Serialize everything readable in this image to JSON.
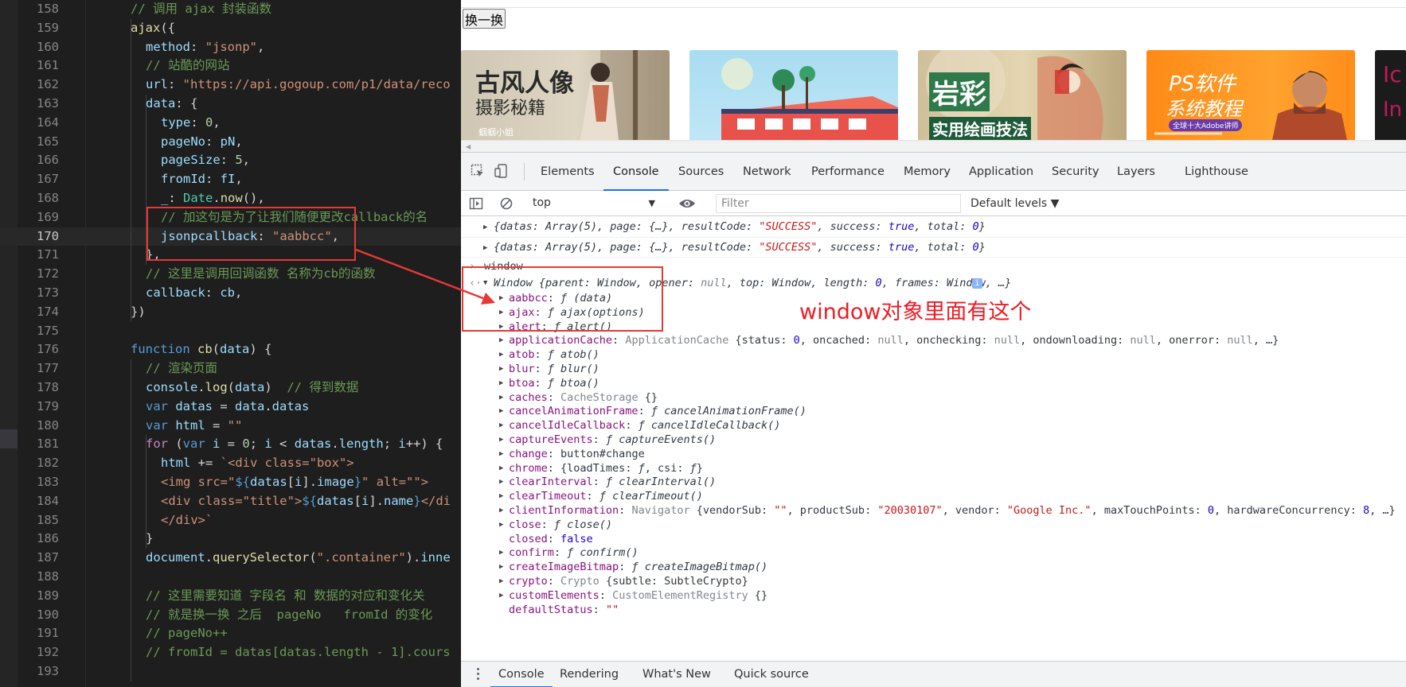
{
  "editor": {
    "lines": [
      {
        "n": "158",
        "ind": 0,
        "segs": [
          [
            "cm",
            "// 调用 ajax 封装函数"
          ]
        ]
      },
      {
        "n": "159",
        "ind": 0,
        "segs": [
          [
            "fn",
            "ajax"
          ],
          [
            "pl",
            "({"
          ]
        ]
      },
      {
        "n": "160",
        "ind": 1,
        "segs": [
          [
            "prop",
            "method"
          ],
          [
            "pl",
            ": "
          ],
          [
            "str",
            "\"jsonp\""
          ],
          [
            "pl",
            ","
          ]
        ]
      },
      {
        "n": "161",
        "ind": 1,
        "segs": [
          [
            "cm",
            "// 站酷的网站"
          ]
        ]
      },
      {
        "n": "162",
        "ind": 1,
        "segs": [
          [
            "prop",
            "url"
          ],
          [
            "pl",
            ": "
          ],
          [
            "str",
            "\"https://api.gogoup.com/p1/data/reco"
          ]
        ]
      },
      {
        "n": "163",
        "ind": 1,
        "segs": [
          [
            "prop",
            "data"
          ],
          [
            "pl",
            ": {"
          ]
        ]
      },
      {
        "n": "164",
        "ind": 2,
        "segs": [
          [
            "prop",
            "type"
          ],
          [
            "pl",
            ": "
          ],
          [
            "num",
            "0"
          ],
          [
            "pl",
            ","
          ]
        ]
      },
      {
        "n": "165",
        "ind": 2,
        "segs": [
          [
            "prop",
            "pageNo"
          ],
          [
            "pl",
            ": "
          ],
          [
            "prop",
            "pN"
          ],
          [
            "pl",
            ","
          ]
        ]
      },
      {
        "n": "166",
        "ind": 2,
        "segs": [
          [
            "prop",
            "pageSize"
          ],
          [
            "pl",
            ": "
          ],
          [
            "num",
            "5"
          ],
          [
            "pl",
            ","
          ]
        ]
      },
      {
        "n": "167",
        "ind": 2,
        "segs": [
          [
            "prop",
            "fromId"
          ],
          [
            "pl",
            ": "
          ],
          [
            "prop",
            "fI"
          ],
          [
            "pl",
            ","
          ]
        ]
      },
      {
        "n": "168",
        "ind": 2,
        "segs": [
          [
            "prop",
            "_"
          ],
          [
            "pl",
            ": "
          ],
          [
            "cls",
            "Date"
          ],
          [
            "pl",
            "."
          ],
          [
            "fn",
            "now"
          ],
          [
            "pl",
            "(),"
          ]
        ]
      },
      {
        "n": "169",
        "ind": 2,
        "segs": [
          [
            "cm",
            "// 加这句是为了让我们随便更改callback的名"
          ]
        ]
      },
      {
        "n": "170",
        "ind": 2,
        "segs": [
          [
            "prop",
            "jsonpcallback"
          ],
          [
            "pl",
            ": "
          ],
          [
            "str",
            "\"aabbcc\""
          ],
          [
            "pl",
            ","
          ]
        ],
        "current": true
      },
      {
        "n": "171",
        "ind": 1,
        "segs": [
          [
            "pl",
            "},"
          ]
        ]
      },
      {
        "n": "172",
        "ind": 1,
        "segs": [
          [
            "cm",
            "// 这里是调用回调函数 名称为cb的函数"
          ]
        ]
      },
      {
        "n": "173",
        "ind": 1,
        "segs": [
          [
            "prop",
            "callback"
          ],
          [
            "pl",
            ": "
          ],
          [
            "prop",
            "cb"
          ],
          [
            "pl",
            ","
          ]
        ]
      },
      {
        "n": "174",
        "ind": 0,
        "segs": [
          [
            "pl",
            "})"
          ]
        ]
      },
      {
        "n": "175",
        "ind": 0,
        "segs": []
      },
      {
        "n": "176",
        "ind": 0,
        "segs": [
          [
            "kw",
            "function "
          ],
          [
            "fn",
            "cb"
          ],
          [
            "pl",
            "("
          ],
          [
            "prop",
            "data"
          ],
          [
            "pl",
            ") {"
          ]
        ]
      },
      {
        "n": "177",
        "ind": 1,
        "segs": [
          [
            "cm",
            "// 渲染页面"
          ]
        ]
      },
      {
        "n": "178",
        "ind": 1,
        "segs": [
          [
            "prop",
            "console"
          ],
          [
            "pl",
            "."
          ],
          [
            "fn",
            "log"
          ],
          [
            "pl",
            "("
          ],
          [
            "prop",
            "data"
          ],
          [
            "pl",
            ")  "
          ],
          [
            "cm",
            "// 得到数据"
          ]
        ]
      },
      {
        "n": "179",
        "ind": 1,
        "segs": [
          [
            "kw",
            "var "
          ],
          [
            "prop",
            "datas"
          ],
          [
            "pl",
            " = "
          ],
          [
            "prop",
            "data"
          ],
          [
            "pl",
            "."
          ],
          [
            "prop",
            "datas"
          ]
        ]
      },
      {
        "n": "180",
        "ind": 1,
        "segs": [
          [
            "kw",
            "var "
          ],
          [
            "prop",
            "html"
          ],
          [
            "pl",
            " = "
          ],
          [
            "str",
            "\"\""
          ]
        ]
      },
      {
        "n": "181",
        "ind": 1,
        "segs": [
          [
            "ctl",
            "for "
          ],
          [
            "pl",
            "("
          ],
          [
            "kw",
            "var "
          ],
          [
            "prop",
            "i"
          ],
          [
            "pl",
            " = "
          ],
          [
            "num",
            "0"
          ],
          [
            "pl",
            "; "
          ],
          [
            "prop",
            "i"
          ],
          [
            "pl",
            " < "
          ],
          [
            "prop",
            "datas"
          ],
          [
            "pl",
            "."
          ],
          [
            "prop",
            "length"
          ],
          [
            "pl",
            "; "
          ],
          [
            "prop",
            "i"
          ],
          [
            "pl",
            "++) {"
          ]
        ]
      },
      {
        "n": "182",
        "ind": 2,
        "segs": [
          [
            "prop",
            "html"
          ],
          [
            "pl",
            " += "
          ],
          [
            "str",
            "`<div class=\"box\">"
          ]
        ]
      },
      {
        "n": "183",
        "ind": 2,
        "segs": [
          [
            "str",
            "<img src=\""
          ],
          [
            "interp",
            "${"
          ],
          [
            "prop",
            "datas"
          ],
          [
            "pl",
            "["
          ],
          [
            "prop",
            "i"
          ],
          [
            "pl",
            "]."
          ],
          [
            "prop",
            "image"
          ],
          [
            "interp",
            "}"
          ],
          [
            "str",
            "\" alt=\"\">"
          ]
        ]
      },
      {
        "n": "184",
        "ind": 2,
        "segs": [
          [
            "str",
            "<div class=\"title\">"
          ],
          [
            "interp",
            "${"
          ],
          [
            "prop",
            "datas"
          ],
          [
            "pl",
            "["
          ],
          [
            "prop",
            "i"
          ],
          [
            "pl",
            "]."
          ],
          [
            "prop",
            "name"
          ],
          [
            "interp",
            "}"
          ],
          [
            "str",
            "</di"
          ]
        ]
      },
      {
        "n": "185",
        "ind": 2,
        "segs": [
          [
            "str",
            "</div>`"
          ]
        ]
      },
      {
        "n": "186",
        "ind": 1,
        "segs": [
          [
            "pl",
            "}"
          ]
        ]
      },
      {
        "n": "187",
        "ind": 1,
        "segs": [
          [
            "prop",
            "document"
          ],
          [
            "pl",
            "."
          ],
          [
            "fn",
            "querySelector"
          ],
          [
            "pl",
            "("
          ],
          [
            "str",
            "\".container\""
          ],
          [
            "pl",
            ")."
          ],
          [
            "prop",
            "inne"
          ]
        ]
      },
      {
        "n": "188",
        "ind": 0,
        "segs": []
      },
      {
        "n": "189",
        "ind": 1,
        "segs": [
          [
            "cm",
            "// 这里需要知道 字段名 和 数据的对应和变化关"
          ]
        ]
      },
      {
        "n": "190",
        "ind": 1,
        "segs": [
          [
            "cm",
            "// 就是换一换 之后  pageNo   fromId 的变化"
          ]
        ]
      },
      {
        "n": "191",
        "ind": 1,
        "segs": [
          [
            "cm",
            "// pageNo++"
          ]
        ]
      },
      {
        "n": "192",
        "ind": 1,
        "segs": [
          [
            "cm",
            "// fromId = datas[datas.length - 1].cours"
          ]
        ]
      },
      {
        "n": "193",
        "ind": 0,
        "segs": []
      }
    ]
  },
  "page": {
    "swap_button": "换一换",
    "cards": [
      {
        "big": "古风人像",
        "mid": "摄影秘籍",
        "small": "蝈蝈小姐"
      },
      {
        "big": "",
        "mid": "",
        "small": ""
      },
      {
        "big": "岩彩",
        "mid": "实用绘画技法",
        "small": ""
      },
      {
        "big": "PS软件",
        "mid": "系统教程",
        "small": "全球十大Adobe讲师"
      },
      {
        "big": "Ic",
        "mid": "In",
        "small": ""
      }
    ]
  },
  "devtools": {
    "tabs": [
      "Elements",
      "Console",
      "Sources",
      "Network",
      "Performance",
      "Memory",
      "Application",
      "Security",
      "Layers",
      "Lighthouse"
    ],
    "active_tab": "Console",
    "context": "top",
    "filter_placeholder": "Filter",
    "levels": "Default levels ▼",
    "drawer_tabs": [
      "Console",
      "Rendering",
      "What's New",
      "Quick source"
    ],
    "active_drawer_tab": "Console",
    "log_lines": [
      [
        [
          "p",
          "{datas: Array(5), page: {…}, resultCode: "
        ],
        [
          "s",
          "\"SUCCESS\""
        ],
        [
          "p",
          ", success: "
        ],
        [
          "n",
          "true"
        ],
        [
          "p",
          ", total: "
        ],
        [
          "n",
          "0"
        ],
        [
          "p",
          "}"
        ]
      ],
      [
        [
          "p",
          "{datas: Array(5), page: {…}, resultCode: "
        ],
        [
          "s",
          "\"SUCCESS\""
        ],
        [
          "p",
          ", success: "
        ],
        [
          "n",
          "true"
        ],
        [
          "p",
          ", total: "
        ],
        [
          "n",
          "0"
        ],
        [
          "p",
          "}"
        ]
      ]
    ],
    "input_echo": "window",
    "window_summary": [
      [
        "p",
        "Window {parent: Window, opener: "
      ],
      [
        "nul",
        "null"
      ],
      [
        "p",
        ", top: Window, length: "
      ],
      [
        "n",
        "0"
      ],
      [
        "p",
        ", frames: Window, …}"
      ]
    ],
    "props": [
      [
        [
          "k",
          "aabbcc"
        ],
        [
          "p",
          ": "
        ],
        [
          "it",
          "ƒ (data)"
        ]
      ],
      [
        [
          "k",
          "ajax"
        ],
        [
          "p",
          ": "
        ],
        [
          "it",
          "ƒ ajax(options)"
        ]
      ],
      [
        [
          "k",
          "alert"
        ],
        [
          "p",
          ": "
        ],
        [
          "it",
          "ƒ alert()"
        ]
      ],
      [
        [
          "k",
          "applicationCache"
        ],
        [
          "p",
          ": "
        ],
        [
          "dim",
          "ApplicationCache "
        ],
        [
          "p",
          "{status: "
        ],
        [
          "n",
          "0"
        ],
        [
          "p",
          ", oncached: "
        ],
        [
          "nul",
          "null"
        ],
        [
          "p",
          ", onchecking: "
        ],
        [
          "nul",
          "null"
        ],
        [
          "p",
          ", ondownloading: "
        ],
        [
          "nul",
          "null"
        ],
        [
          "p",
          ", onerror: "
        ],
        [
          "nul",
          "null"
        ],
        [
          "p",
          ", …}"
        ]
      ],
      [
        [
          "k",
          "atob"
        ],
        [
          "p",
          ": "
        ],
        [
          "it",
          "ƒ atob()"
        ]
      ],
      [
        [
          "k",
          "blur"
        ],
        [
          "p",
          ": "
        ],
        [
          "it",
          "ƒ blur()"
        ]
      ],
      [
        [
          "k",
          "btoa"
        ],
        [
          "p",
          ": "
        ],
        [
          "it",
          "ƒ btoa()"
        ]
      ],
      [
        [
          "k",
          "caches"
        ],
        [
          "p",
          ": "
        ],
        [
          "dim",
          "CacheStorage "
        ],
        [
          "p",
          "{}"
        ]
      ],
      [
        [
          "k",
          "cancelAnimationFrame"
        ],
        [
          "p",
          ": "
        ],
        [
          "it",
          "ƒ cancelAnimationFrame()"
        ]
      ],
      [
        [
          "k",
          "cancelIdleCallback"
        ],
        [
          "p",
          ": "
        ],
        [
          "it",
          "ƒ cancelIdleCallback()"
        ]
      ],
      [
        [
          "k",
          "captureEvents"
        ],
        [
          "p",
          ": "
        ],
        [
          "it",
          "ƒ captureEvents()"
        ]
      ],
      [
        [
          "k",
          "change"
        ],
        [
          "p",
          ": button#change"
        ]
      ],
      [
        [
          "k",
          "chrome"
        ],
        [
          "p",
          ": {loadTimes: "
        ],
        [
          "it",
          "ƒ"
        ],
        [
          "p",
          ", csi: "
        ],
        [
          "it",
          "ƒ"
        ],
        [
          "p",
          "}"
        ]
      ],
      [
        [
          "k",
          "clearInterval"
        ],
        [
          "p",
          ": "
        ],
        [
          "it",
          "ƒ clearInterval()"
        ]
      ],
      [
        [
          "k",
          "clearTimeout"
        ],
        [
          "p",
          ": "
        ],
        [
          "it",
          "ƒ clearTimeout()"
        ]
      ],
      [
        [
          "k",
          "clientInformation"
        ],
        [
          "p",
          ": "
        ],
        [
          "dim",
          "Navigator "
        ],
        [
          "p",
          "{vendorSub: "
        ],
        [
          "s",
          "\"\""
        ],
        [
          "p",
          ", productSub: "
        ],
        [
          "s",
          "\"20030107\""
        ],
        [
          "p",
          ", vendor: "
        ],
        [
          "s",
          "\"Google Inc.\""
        ],
        [
          "p",
          ", maxTouchPoints: "
        ],
        [
          "n",
          "0"
        ],
        [
          "p",
          ", hardwareConcurrency: "
        ],
        [
          "n",
          "8"
        ],
        [
          "p",
          ", …}"
        ]
      ],
      [
        [
          "k",
          "close"
        ],
        [
          "p",
          ": "
        ],
        [
          "it",
          "ƒ close()"
        ]
      ],
      [
        [
          "k",
          "closed"
        ],
        [
          "p",
          ": "
        ],
        [
          "n",
          "false"
        ]
      ],
      [
        [
          "k",
          "confirm"
        ],
        [
          "p",
          ": "
        ],
        [
          "it",
          "ƒ confirm()"
        ]
      ],
      [
        [
          "k",
          "createImageBitmap"
        ],
        [
          "p",
          ": "
        ],
        [
          "it",
          "ƒ createImageBitmap()"
        ]
      ],
      [
        [
          "k",
          "crypto"
        ],
        [
          "p",
          ": "
        ],
        [
          "dim",
          "Crypto "
        ],
        [
          "p",
          "{subtle: SubtleCrypto}"
        ]
      ],
      [
        [
          "k",
          "customElements"
        ],
        [
          "p",
          ": "
        ],
        [
          "dim",
          "CustomElementRegistry "
        ],
        [
          "p",
          "{}"
        ]
      ],
      [
        [
          "k",
          "defaultStatus"
        ],
        [
          "p",
          ": "
        ],
        [
          "s",
          "\"\""
        ]
      ]
    ],
    "no_triangle": [
      "closed",
      "defaultStatus"
    ]
  },
  "annotation": {
    "text": "window对象里面有这个",
    "color": "#ec1c24"
  }
}
